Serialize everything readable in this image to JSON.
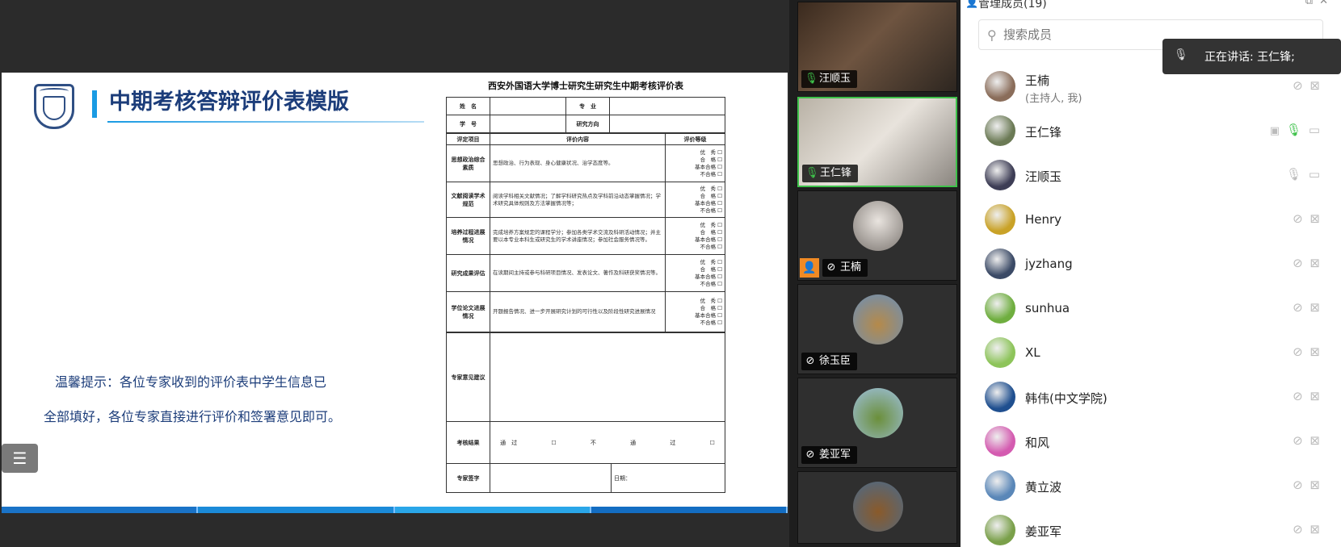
{
  "slide": {
    "title": "中期考核答辩评价表模版",
    "tip_line1": "温馨提示：各位专家收到的评价表中学生信息已",
    "tip_line2": "全部填好，各位专家直接进行评价和签署意见即可。",
    "outline_icon": "list-icon",
    "form": {
      "title": "西安外国语大学博士研究生研究生中期考核评价表",
      "name_label": "姓　名",
      "major_label": "专　业",
      "id_label": "学　号",
      "direction_label": "研究方向",
      "col_item": "评定项目",
      "col_content": "评价内容",
      "col_grade": "评价等级",
      "grades": [
        "优　秀 ☐",
        "合　格 ☐",
        "基本合格 ☐",
        "不合格 ☐"
      ],
      "rows": [
        {
          "item": "思想政治综合素质",
          "content": "思想政治、行为表现、身心健康状况、治学态度等。"
        },
        {
          "item": "文献阅读学术规范",
          "content": "阅读学科相关文献情况；了解学科研究热点及学科前沿动态掌握情况；学术研究具体规则及方法掌握情况等；"
        },
        {
          "item": "培养过程进展情况",
          "content": "完成培养方案规定的课程学分；参加各类学术交流及科研活动情况；并主要以本专业本科生或研究生的学术讲座情况；参加社会服务情况等。"
        },
        {
          "item": "研究成果评估",
          "content": "在读期间主持或参与科研项目情况、发表论文、著作及科研获奖情况等。"
        },
        {
          "item": "学位论文进展情况",
          "content": "开题报告情况、进一步开展研究计划的可行性以及阶段性研究进展情况"
        }
      ],
      "expert_opinion_label": "专家意见建议",
      "result_label": "考核结果",
      "pass_label": "通　过 ☐",
      "fail_label": "不 通 过 ☐",
      "sign_label": "专家签字",
      "date_label": "日期："
    }
  },
  "videos": [
    {
      "name": "汪顺玉",
      "mic": "on"
    },
    {
      "name": "王仁锋",
      "mic": "on",
      "active": true
    },
    {
      "name": "王楠",
      "mic": "muted",
      "user_icon": true
    },
    {
      "name": "徐玉臣",
      "mic": "muted"
    },
    {
      "name": "姜亚军",
      "mic": "muted"
    },
    {
      "name": "",
      "mic": "none"
    }
  ],
  "panel": {
    "title": "管理成员(19)",
    "search_placeholder": "搜索成员",
    "speaking_toast": "正在讲话: 王仁锋;",
    "members": [
      {
        "name": "王楠",
        "sub": "(主持人, 我)",
        "color": "#8a6d5a",
        "mic": "muted",
        "cam": "off"
      },
      {
        "name": "王仁锋",
        "sub": "",
        "color": "#6b7a55",
        "mic": "on",
        "cam": "on",
        "screen": true
      },
      {
        "name": "汪顺玉",
        "sub": "",
        "color": "#3d3d55",
        "mic": "idle",
        "cam": "on"
      },
      {
        "name": "Henry",
        "sub": "",
        "color": "#c9a227",
        "mic": "muted",
        "cam": "off"
      },
      {
        "name": "jyzhang",
        "sub": "",
        "color": "#3b4a66",
        "mic": "muted",
        "cam": "off"
      },
      {
        "name": "sunhua",
        "sub": "",
        "color": "#6fae3f",
        "mic": "muted",
        "cam": "off"
      },
      {
        "name": "XL",
        "sub": "",
        "color": "#8dc45a",
        "mic": "muted",
        "cam": "off"
      },
      {
        "name": "韩伟(中文学院)",
        "sub": "",
        "color": "#1f4f8f",
        "mic": "muted",
        "cam": "off"
      },
      {
        "name": "和风",
        "sub": "",
        "color": "#d45bb0",
        "mic": "muted",
        "cam": "off"
      },
      {
        "name": "黄立波",
        "sub": "",
        "color": "#5a87b8",
        "mic": "muted",
        "cam": "off"
      },
      {
        "name": "姜亚军",
        "sub": "",
        "color": "#7aa04a",
        "mic": "muted",
        "cam": "off"
      }
    ]
  }
}
